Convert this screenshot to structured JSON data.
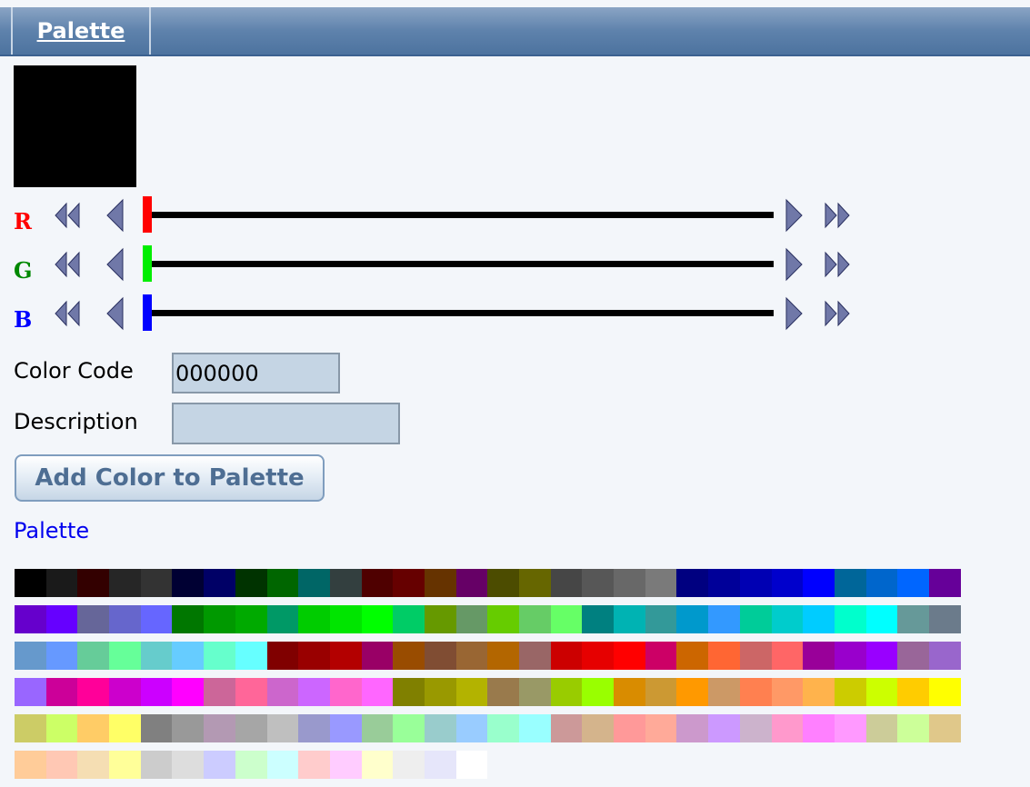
{
  "tab": {
    "label": "Palette"
  },
  "current_color": "#000000",
  "sliders": [
    {
      "letter": "R",
      "color": "#ff0000",
      "letter_color": "#ff0000",
      "value": 0
    },
    {
      "letter": "G",
      "color": "#00ee00",
      "letter_color": "#008800",
      "value": 0
    },
    {
      "letter": "B",
      "color": "#0000ff",
      "letter_color": "#0000ff",
      "value": 0
    }
  ],
  "form": {
    "color_code_label": "Color Code",
    "color_code_value": "000000",
    "description_label": "Description",
    "description_value": ""
  },
  "add_button": {
    "label": "Add Color to Palette"
  },
  "palette": {
    "title": "Palette",
    "rows": [
      [
        "#000000",
        "#1a1a1a",
        "#330000",
        "#262626",
        "#333333",
        "#000033",
        "#000066",
        "#003300",
        "#006600",
        "#006666",
        "#333f3f",
        "#4f0000",
        "#660000",
        "#663300",
        "#660066",
        "#4c4c00",
        "#666600",
        "#464646",
        "#575757",
        "#686868",
        "#7a7a7a",
        "#000080",
        "#000099",
        "#0000b3",
        "#0000cc",
        "#0000ff",
        "#006699",
        "#0066cc",
        "#0066ff",
        "#660099"
      ],
      [
        "#6600cc",
        "#6600ff",
        "#666699",
        "#6666cc",
        "#6666ff",
        "#007700",
        "#009900",
        "#00aa00",
        "#009966",
        "#00cc00",
        "#00e500",
        "#00ff00",
        "#00cc66",
        "#669900",
        "#669966",
        "#66cc00",
        "#66cc66",
        "#66ff66",
        "#008080",
        "#00b3b3",
        "#339999",
        "#0099cc",
        "#3399ff",
        "#00cc99",
        "#00cccc",
        "#00ccff",
        "#00ffcc",
        "#00ffff",
        "#669999",
        "#6b7b8b"
      ],
      [
        "#6699cc",
        "#6699ff",
        "#66cc99",
        "#66ff99",
        "#66cccc",
        "#66ccff",
        "#66ffcc",
        "#66ffff",
        "#800000",
        "#990000",
        "#b30000",
        "#990066",
        "#994c00",
        "#804d33",
        "#996633",
        "#b36600",
        "#996666",
        "#cc0000",
        "#e60000",
        "#ff0000",
        "#cc0066",
        "#cc6600",
        "#ff6633",
        "#cc6666",
        "#ff6666",
        "#990099",
        "#9900cc",
        "#9900ff",
        "#996699",
        "#9966cc"
      ],
      [
        "#9966ff",
        "#cc0099",
        "#ff0099",
        "#cc00cc",
        "#cc00ff",
        "#ff00ff",
        "#cc6699",
        "#ff6699",
        "#cc66cc",
        "#cc66ff",
        "#ff66cc",
        "#ff66ff",
        "#808000",
        "#999900",
        "#b3b300",
        "#997a4c",
        "#999966",
        "#99cc00",
        "#99ff00",
        "#d98c00",
        "#cc9933",
        "#ff9900",
        "#cc9966",
        "#ff8050",
        "#ff9966",
        "#ffb34c",
        "#cccc00",
        "#ccff00",
        "#ffcc00",
        "#ffff00"
      ],
      [
        "#cccc66",
        "#ccff66",
        "#ffcc66",
        "#ffff66",
        "#808080",
        "#999999",
        "#b399b3",
        "#a6a6a6",
        "#bfbfbf",
        "#9999cc",
        "#9999ff",
        "#99cc99",
        "#99ff99",
        "#99cccc",
        "#99ccff",
        "#99ffcc",
        "#99ffff",
        "#cc9999",
        "#d4b48c",
        "#ff9999",
        "#ffaa99",
        "#cc99cc",
        "#cc99ff",
        "#ccb3cc",
        "#ff99cc",
        "#ff80ff",
        "#ff99ff",
        "#cccc99",
        "#ccff99",
        "#e0c88a"
      ],
      [
        "#ffcc99",
        "#ffc8b4",
        "#f5deb3",
        "#ffff99",
        "#cccccc",
        "#dddddd",
        "#ccccff",
        "#ccffcc",
        "#ccffff",
        "#ffcccc",
        "#ffccff",
        "#ffffcc",
        "#eeeeee",
        "#e6e6fa",
        "#ffffff"
      ]
    ]
  }
}
